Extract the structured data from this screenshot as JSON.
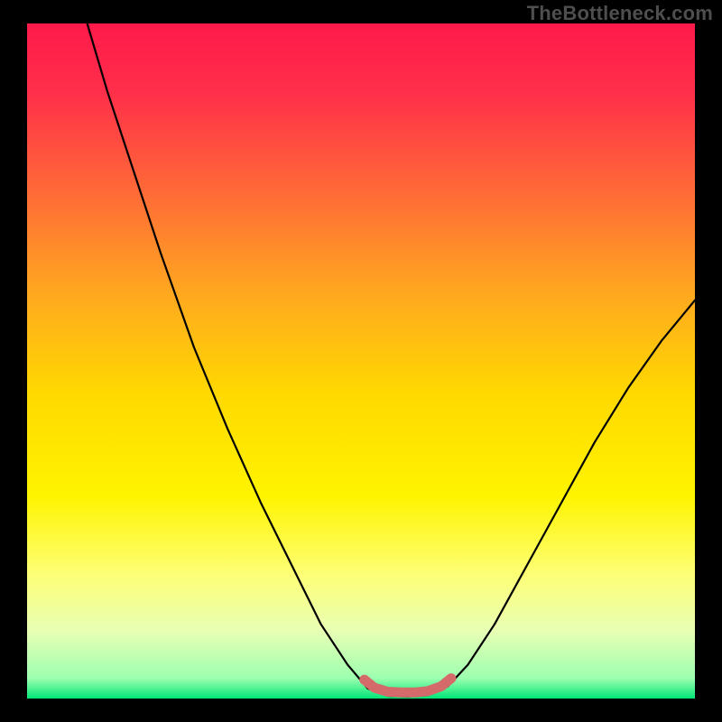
{
  "watermark": "TheBottleneck.com",
  "chart_data": {
    "type": "line",
    "title": "",
    "xlabel": "",
    "ylabel": "",
    "xlim": [
      0,
      100
    ],
    "ylim": [
      0,
      100
    ],
    "background_gradient": {
      "stops": [
        {
          "offset": 0.0,
          "color": "#ff1a4b"
        },
        {
          "offset": 0.1,
          "color": "#ff2e4a"
        },
        {
          "offset": 0.25,
          "color": "#ff6a37"
        },
        {
          "offset": 0.4,
          "color": "#ffa81f"
        },
        {
          "offset": 0.55,
          "color": "#ffd900"
        },
        {
          "offset": 0.7,
          "color": "#fff400"
        },
        {
          "offset": 0.82,
          "color": "#fdff7a"
        },
        {
          "offset": 0.9,
          "color": "#e8ffb4"
        },
        {
          "offset": 0.97,
          "color": "#9dffb0"
        },
        {
          "offset": 1.0,
          "color": "#00e676"
        }
      ]
    },
    "series": [
      {
        "name": "bottleneck-curve",
        "color": "#000000",
        "width": 2.2,
        "points": [
          {
            "x": 9.0,
            "y": 100.0
          },
          {
            "x": 12.0,
            "y": 90.0
          },
          {
            "x": 16.0,
            "y": 78.0
          },
          {
            "x": 20.0,
            "y": 66.0
          },
          {
            "x": 25.0,
            "y": 52.0
          },
          {
            "x": 30.0,
            "y": 40.0
          },
          {
            "x": 35.0,
            "y": 29.0
          },
          {
            "x": 40.0,
            "y": 19.0
          },
          {
            "x": 44.0,
            "y": 11.0
          },
          {
            "x": 48.0,
            "y": 5.0
          },
          {
            "x": 51.0,
            "y": 1.5
          },
          {
            "x": 54.0,
            "y": 0.4
          },
          {
            "x": 57.0,
            "y": 0.3
          },
          {
            "x": 60.0,
            "y": 0.5
          },
          {
            "x": 63.0,
            "y": 1.8
          },
          {
            "x": 66.0,
            "y": 5.0
          },
          {
            "x": 70.0,
            "y": 11.0
          },
          {
            "x": 75.0,
            "y": 20.0
          },
          {
            "x": 80.0,
            "y": 29.0
          },
          {
            "x": 85.0,
            "y": 38.0
          },
          {
            "x": 90.0,
            "y": 46.0
          },
          {
            "x": 95.0,
            "y": 53.0
          },
          {
            "x": 100.0,
            "y": 59.0
          }
        ]
      },
      {
        "name": "optimal-band",
        "color": "#d46a6a",
        "width": 11,
        "linecap": "round",
        "points": [
          {
            "x": 50.5,
            "y": 2.8
          },
          {
            "x": 52.0,
            "y": 1.6
          },
          {
            "x": 54.0,
            "y": 1.0
          },
          {
            "x": 56.0,
            "y": 0.9
          },
          {
            "x": 58.0,
            "y": 0.9
          },
          {
            "x": 60.0,
            "y": 1.1
          },
          {
            "x": 62.0,
            "y": 1.8
          },
          {
            "x": 63.5,
            "y": 3.0
          }
        ]
      }
    ]
  }
}
